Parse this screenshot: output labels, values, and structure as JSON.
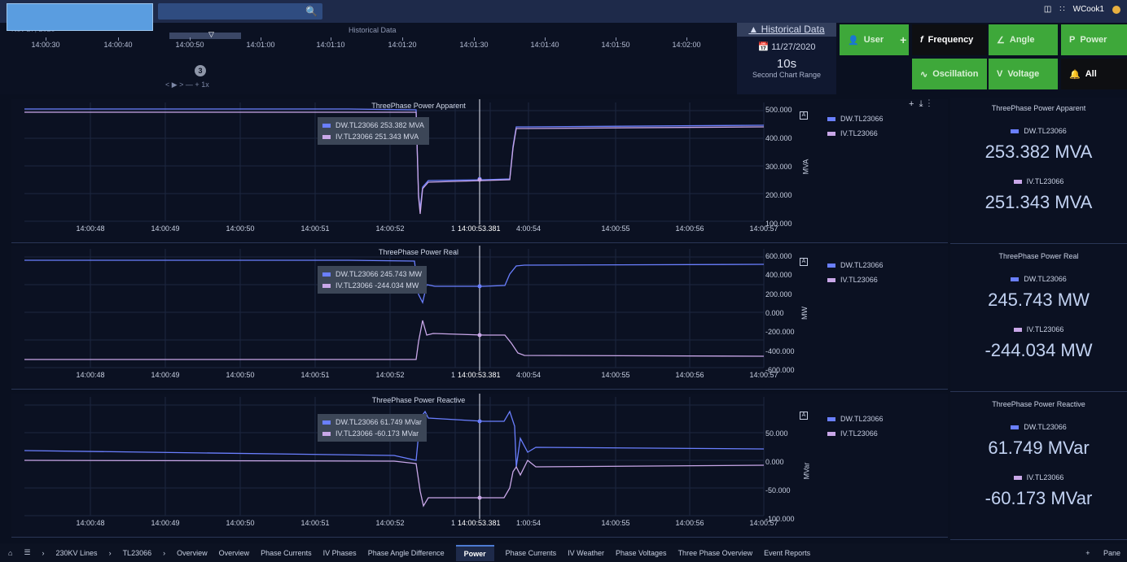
{
  "top": {
    "user": "WCook1"
  },
  "timeline": {
    "title": "Historical Data",
    "date": "Nov 27, 2020",
    "ticks": [
      "14:00:30",
      "14:00:40",
      "14:00:50",
      "14:01:00",
      "14:01:10",
      "14:01:20",
      "14:01:30",
      "14:01:40",
      "14:01:50",
      "14:02:00"
    ],
    "badge": "3",
    "controls": "< ▶ >   —  + 1x"
  },
  "historical": {
    "title": "Historical Data",
    "date": "11/27/2020",
    "range": "10s",
    "range_label": "Second Chart Range"
  },
  "buttons": {
    "user": "User",
    "frequency": "Frequency",
    "angle": "Angle",
    "power": "Power",
    "oscillation": "Oscillation",
    "voltage": "Voltage",
    "all": "All"
  },
  "colors": {
    "dw": "#6a7fff",
    "iv": "#c9a7e8",
    "accent": "#3ea83a"
  },
  "charts": [
    {
      "title": "ThreePhase Power Apparent",
      "unit": "MVA",
      "yticks": [
        "500.000",
        "400.000",
        "300.000",
        "200.000",
        "100.000"
      ],
      "tooltip": {
        "dw": "DW.TL23066 253.382 MVA",
        "iv": "IV.TL23066   251.343 MVA"
      },
      "legend": [
        "DW.TL23066",
        "IV.TL23066"
      ],
      "xticks": [
        "14:00:48",
        "14:00:49",
        "14:00:50",
        "14:00:51",
        "14:00:52",
        "14",
        "14:00:53.381",
        "4:00:54",
        "14:00:55",
        "14:00:56",
        "14:00:57"
      ]
    },
    {
      "title": "ThreePhase Power Real",
      "unit": "MW",
      "yticks": [
        "600.000",
        "400.000",
        "200.000",
        "0.000",
        "-200.000",
        "-400.000",
        "-600.000"
      ],
      "tooltip": {
        "dw": "DW.TL23066 245.743 MW",
        "iv": "IV.TL23066   -244.034 MW"
      },
      "legend": [
        "DW.TL23066",
        "IV.TL23066"
      ],
      "xticks": [
        "14:00:48",
        "14:00:49",
        "14:00:50",
        "14:00:51",
        "14:00:52",
        "14",
        "14:00:53.381",
        "4:00:54",
        "14:00:55",
        "14:00:56",
        "14:00:57"
      ]
    },
    {
      "title": "ThreePhase Power Reactive",
      "unit": "MVar",
      "yticks": [
        "50.000",
        "0.000",
        "-50.000",
        "-100.000"
      ],
      "tooltip": {
        "dw": "DW.TL23066 61.749 MVar",
        "iv": "IV.TL23066   -60.173 MVar"
      },
      "legend": [
        "DW.TL23066",
        "IV.TL23066"
      ],
      "xticks": [
        "14:00:48",
        "14:00:49",
        "14:00:50",
        "14:00:51",
        "14:00:52",
        "14",
        "14:00:53.381",
        "1:00:54",
        "14:00:55",
        "14:00:56",
        "14:00:57"
      ]
    }
  ],
  "side": [
    {
      "title": "ThreePhase Power Apparent",
      "dw_label": "DW.TL23066",
      "dw_value": "253.382 MVA",
      "iv_label": "IV.TL23066",
      "iv_value": "251.343 MVA"
    },
    {
      "title": "ThreePhase Power Real",
      "dw_label": "DW.TL23066",
      "dw_value": "245.743 MW",
      "iv_label": "IV.TL23066",
      "iv_value": "-244.034 MW"
    },
    {
      "title": "ThreePhase Power Reactive",
      "dw_label": "DW.TL23066",
      "dw_value": "61.749 MVar",
      "iv_label": "IV.TL23066",
      "iv_value": "-60.173 MVar"
    }
  ],
  "bottom": {
    "items": [
      "230KV Lines",
      "TL23066",
      "Overview",
      "Overview",
      "Phase Currents",
      "IV Phases",
      "Phase Angle Difference",
      "Power",
      "Phase Currents",
      "IV Weather",
      "Phase Voltages",
      "Three Phase Overview",
      "Event Reports"
    ],
    "right": "Pane"
  }
}
